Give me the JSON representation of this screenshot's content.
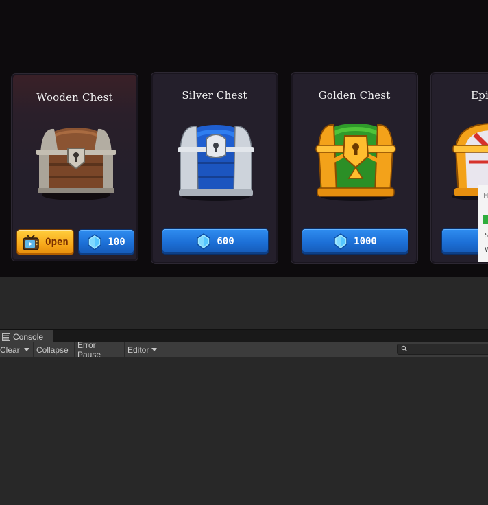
{
  "game": {
    "chests": [
      {
        "title": "Wooden Chest",
        "open_label": "Open",
        "price": "100",
        "chest_icon": "wooden-chest",
        "accent": "#8b5a36"
      },
      {
        "title": "Silver Chest",
        "price": "600",
        "chest_icon": "silver-chest",
        "accent": "#2e6fd6"
      },
      {
        "title": "Golden Chest",
        "price": "1000",
        "chest_icon": "golden-chest",
        "accent": "#f2a31b"
      },
      {
        "title": "Epic",
        "chest_icon": "epic-chest",
        "accent": "#d6322b"
      }
    ],
    "button_colors": {
      "gem": "#1f6fd8",
      "open": "#f6a71b"
    },
    "popup": {
      "h": "H",
      "s": "S",
      "w": "W"
    }
  },
  "console": {
    "tab_label": "Console",
    "toolbar": {
      "clear": "Clear",
      "collapse": "Collapse",
      "error_pause": "Error Pause",
      "editor": "Editor"
    },
    "search": {
      "value": "",
      "icon": "search-icon"
    }
  }
}
